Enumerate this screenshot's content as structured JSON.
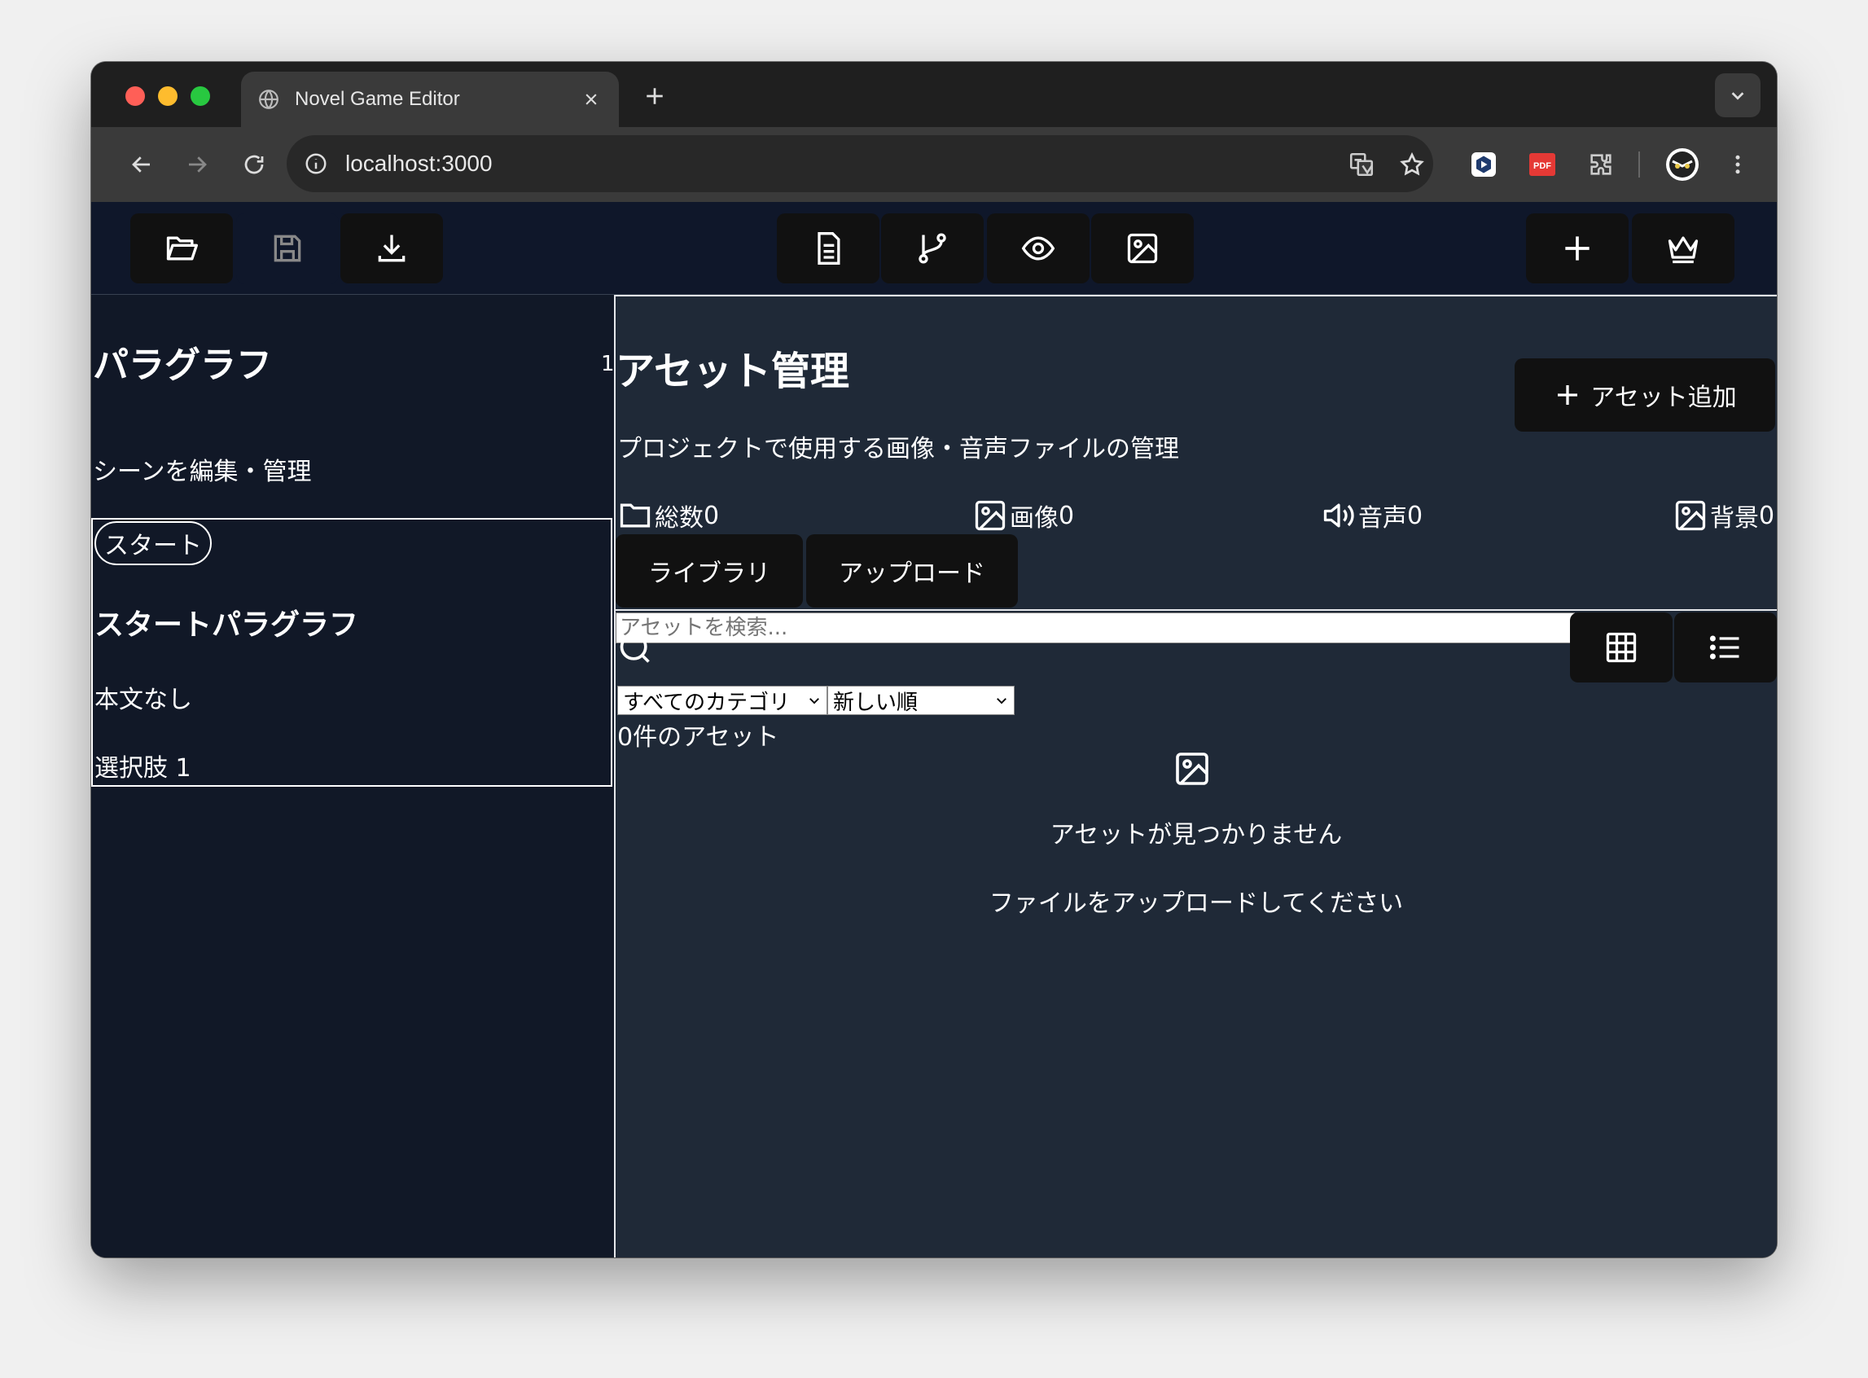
{
  "browser": {
    "tab_title": "Novel Game Editor",
    "url": "localhost:3000",
    "pdf_label": "PDF"
  },
  "sidebar": {
    "title": "パラグラフ",
    "count": "1",
    "description": "シーンを編集・管理",
    "card": {
      "badge": "スタート",
      "title": "スタートパラグラフ",
      "body": "本文なし",
      "choice": "選択肢 1"
    }
  },
  "main": {
    "title": "アセット管理",
    "subtitle": "プロジェクトで使用する画像・音声ファイルの管理",
    "add_button": "アセット追加",
    "stats": [
      {
        "label": "総数",
        "value": "0"
      },
      {
        "label": "画像",
        "value": "0"
      },
      {
        "label": "音声",
        "value": "0"
      },
      {
        "label": "背景",
        "value": "0"
      }
    ],
    "tabs": [
      "ライブラリ",
      "アップロード"
    ],
    "search_placeholder": "アセットを検索...",
    "category_select": "すべてのカテゴリ",
    "sort_select": "新しい順",
    "asset_count": "0件のアセット",
    "empty_title": "アセットが見つかりません",
    "empty_subtitle": "ファイルをアップロードしてください"
  },
  "colors": {
    "app_bg": "#111827",
    "main_bg": "#1f2937",
    "appbar_bg": "#0f172a",
    "button_bg": "#111111"
  }
}
